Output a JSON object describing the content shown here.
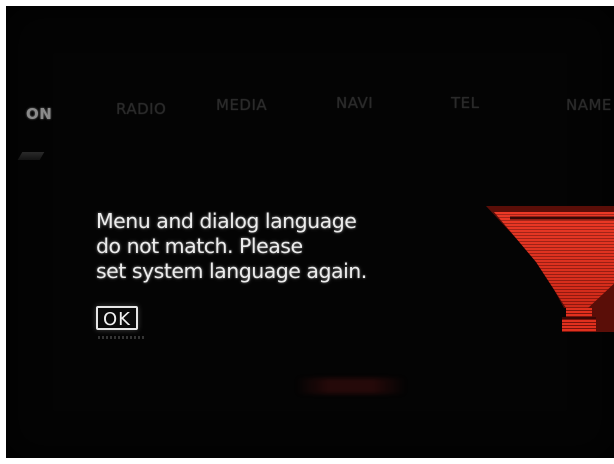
{
  "menu": {
    "tabs": [
      {
        "label": "ON",
        "active": true
      },
      {
        "label": "RADIO",
        "active": false
      },
      {
        "label": "MEDIA",
        "active": false
      },
      {
        "label": "NAVI",
        "active": false
      },
      {
        "label": "TEL",
        "active": false
      },
      {
        "label": "NAME",
        "active": false
      }
    ]
  },
  "dialog": {
    "lines": [
      "Menu and dialog language",
      "do not match. Please",
      "set system language again."
    ],
    "ok_label": "OK"
  },
  "graphic": {
    "icon": "red-funnel-icon",
    "color": "#e0301e"
  },
  "colors": {
    "background": "#040404",
    "text": "#ececec",
    "accent": "#e0301e"
  }
}
